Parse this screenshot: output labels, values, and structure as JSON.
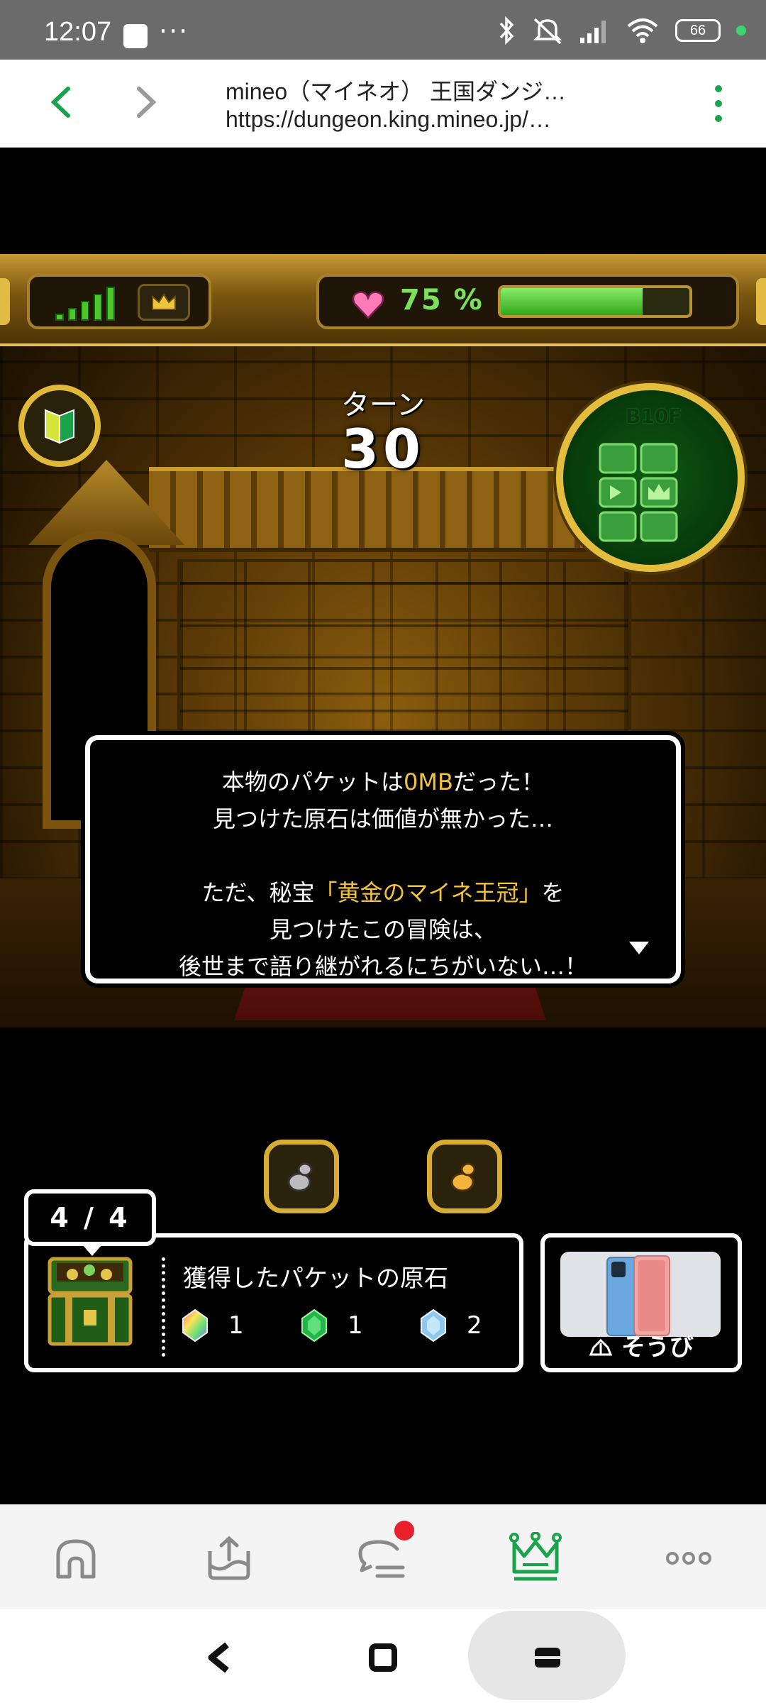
{
  "status_bar": {
    "time": "12:07",
    "more_dots": "···",
    "battery": "66"
  },
  "browser": {
    "page_title": "mineo（マイネオ） 王国ダンジ…",
    "url": "https://dungeon.king.mineo.jp/…"
  },
  "hud": {
    "signal_bars": 5,
    "hp_value": "75",
    "hp_unit": "%",
    "hp_fraction": 0.75,
    "colors": {
      "hp": "#7ee05a",
      "gold": "#e4bd3c",
      "heart": "#ff7ab8"
    }
  },
  "turn": {
    "label": "ターン",
    "value": "30"
  },
  "minimap": {
    "floor": "B10F"
  },
  "message": {
    "line1_pre": "本物のパケットは",
    "line1_hl": "0MB",
    "line1_post": "だった！",
    "line2": "見つけた原石は価値が無かった…",
    "line3_pre": "ただ、秘宝",
    "line3_hl": "「黄金のマイネ王冠」",
    "line3_post": "を",
    "line4": "見つけたこの冒険は、",
    "line5": "後世まで語り継がれるにちがいない…！"
  },
  "loot": {
    "count": "4 / 4",
    "title": "獲得したパケットの原石",
    "gems": [
      {
        "icon": "rainbow-gem-icon",
        "count": "1"
      },
      {
        "icon": "green-gem-icon",
        "count": "1"
      },
      {
        "icon": "blue-gem-icon",
        "count": "2"
      }
    ]
  },
  "equipment": {
    "label": "そうび"
  },
  "app_nav": {
    "items": [
      "home-icon",
      "upload-icon",
      "chat-icon",
      "crown-icon",
      "more-icon"
    ],
    "active": "crown-icon",
    "active_color": "#1aa34a"
  }
}
